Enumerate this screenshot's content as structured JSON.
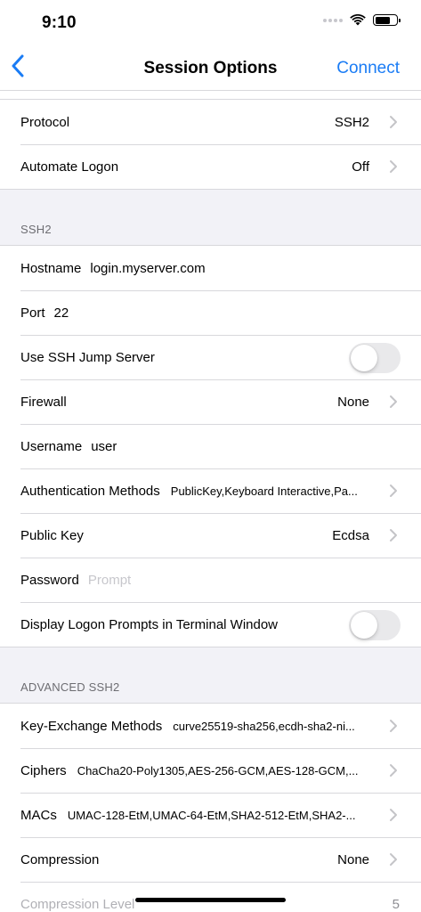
{
  "status": {
    "time": "9:10"
  },
  "nav": {
    "title": "Session Options",
    "action": "Connect"
  },
  "general": {
    "rows": [
      {
        "label": "Protocol",
        "value": "SSH2"
      },
      {
        "label": "Automate Logon",
        "value": "Off"
      }
    ]
  },
  "ssh2": {
    "header": "SSH2",
    "hostname": {
      "label": "Hostname",
      "value": "login.myserver.com"
    },
    "port": {
      "label": "Port",
      "value": "22"
    },
    "jump_server": {
      "label": "Use SSH Jump Server",
      "on": false
    },
    "firewall": {
      "label": "Firewall",
      "value": "None"
    },
    "username": {
      "label": "Username",
      "value": "user"
    },
    "auth_methods": {
      "label": "Authentication Methods",
      "value": "PublicKey,Keyboard Interactive,Pa..."
    },
    "public_key": {
      "label": "Public Key",
      "value": "Ecdsa"
    },
    "password": {
      "label": "Password",
      "placeholder": "Prompt"
    },
    "display_prompts": {
      "label": "Display Logon Prompts in Terminal Window",
      "on": false
    }
  },
  "advanced": {
    "header": "ADVANCED SSH2",
    "kex": {
      "label": "Key-Exchange Methods",
      "value": "curve25519-sha256,ecdh-sha2-ni..."
    },
    "ciphers": {
      "label": "Ciphers",
      "value": "ChaCha20-Poly1305,AES-256-GCM,AES-128-GCM,..."
    },
    "macs": {
      "label": "MACs",
      "value": "UMAC-128-EtM,UMAC-64-EtM,SHA2-512-EtM,SHA2-..."
    },
    "compression": {
      "label": "Compression",
      "value": "None"
    },
    "compression_level": {
      "label": "Compression Level",
      "value": "5",
      "fraction": 0.48
    }
  },
  "colors": {
    "accent": "#1a7cf5",
    "background": "#f2f2f7"
  }
}
